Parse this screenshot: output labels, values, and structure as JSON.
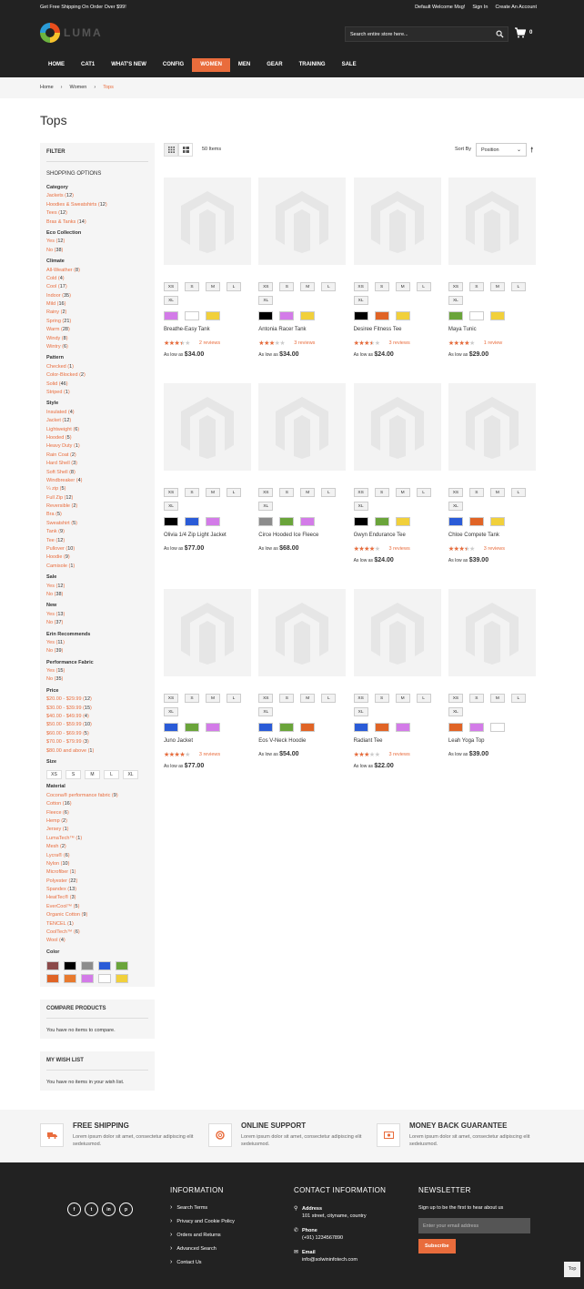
{
  "header": {
    "promo": "Get Free Shipping On Order Over $99!",
    "welcome": "Default Welcome Msg!",
    "sign_in": "Sign In",
    "create_account": "Create An Account",
    "logo_text": "LUMA",
    "search_placeholder": "Search entire store here...",
    "cart_count": "0",
    "nav": [
      {
        "label": "HOME"
      },
      {
        "label": "CAT1"
      },
      {
        "label": "WHAT'S NEW"
      },
      {
        "label": "CONFIG"
      },
      {
        "label": "WOMEN",
        "active": true
      },
      {
        "label": "MEN"
      },
      {
        "label": "GEAR"
      },
      {
        "label": "TRAINING"
      },
      {
        "label": "SALE"
      }
    ]
  },
  "breadcrumb": [
    "Home",
    "Women",
    "Tops"
  ],
  "page_title": "Tops",
  "filter": {
    "title": "FILTER",
    "subtitle": "SHOPPING OPTIONS",
    "groups": [
      {
        "name": "Category",
        "items": [
          [
            "Jackets",
            "12"
          ],
          [
            "Hoodies & Sweatshirts",
            "12"
          ],
          [
            "Tees",
            "12"
          ],
          [
            "Bras & Tanks",
            "14"
          ]
        ]
      },
      {
        "name": "Eco Collection",
        "items": [
          [
            "Yes",
            "12"
          ],
          [
            "No",
            "38"
          ]
        ]
      },
      {
        "name": "Climate",
        "items": [
          [
            "All-Weather",
            "8"
          ],
          [
            "Cold",
            "4"
          ],
          [
            "Cool",
            "17"
          ],
          [
            "Indoor",
            "35"
          ],
          [
            "Mild",
            "16"
          ],
          [
            "Rainy",
            "2"
          ],
          [
            "Spring",
            "21"
          ],
          [
            "Warm",
            "28"
          ],
          [
            "Windy",
            "8"
          ],
          [
            "Wintry",
            "6"
          ]
        ]
      },
      {
        "name": "Pattern",
        "items": [
          [
            "Checked",
            "1"
          ],
          [
            "Color-Blocked",
            "2"
          ],
          [
            "Solid",
            "46"
          ],
          [
            "Striped",
            "1"
          ]
        ]
      },
      {
        "name": "Style",
        "items": [
          [
            "Insulated",
            "4"
          ],
          [
            "Jacket",
            "12"
          ],
          [
            "Lightweight",
            "6"
          ],
          [
            "Hooded",
            "5"
          ],
          [
            "Heavy Duty",
            "1"
          ],
          [
            "Rain Coat",
            "2"
          ],
          [
            "Hard Shell",
            "3"
          ],
          [
            "Soft Shell",
            "8"
          ],
          [
            "Windbreaker",
            "4"
          ],
          [
            "¼ zip",
            "5"
          ],
          [
            "Full Zip",
            "12"
          ],
          [
            "Reversible",
            "2"
          ],
          [
            "Bra",
            "5"
          ],
          [
            "Sweatshirt",
            "5"
          ],
          [
            "Tank",
            "9"
          ],
          [
            "Tee",
            "12"
          ],
          [
            "Pullover",
            "10"
          ],
          [
            "Hoodie",
            "9"
          ],
          [
            "Camisole",
            "1"
          ]
        ]
      },
      {
        "name": "Sale",
        "items": [
          [
            "Yes",
            "12"
          ],
          [
            "No",
            "38"
          ]
        ]
      },
      {
        "name": "New",
        "items": [
          [
            "Yes",
            "13"
          ],
          [
            "No",
            "37"
          ]
        ]
      },
      {
        "name": "Erin Recommends",
        "items": [
          [
            "Yes",
            "11"
          ],
          [
            "No",
            "39"
          ]
        ]
      },
      {
        "name": "Performance Fabric",
        "items": [
          [
            "Yes",
            "15"
          ],
          [
            "No",
            "35"
          ]
        ]
      },
      {
        "name": "Price",
        "items": [
          [
            "$20.00 - $29.99",
            "12"
          ],
          [
            "$30.00 - $39.99",
            "15"
          ],
          [
            "$40.00 - $49.99",
            "4"
          ],
          [
            "$50.00 - $59.99",
            "10"
          ],
          [
            "$60.00 - $69.99",
            "5"
          ],
          [
            "$70.00 - $79.99",
            "3"
          ],
          [
            "$80.00 and above",
            "1"
          ]
        ]
      }
    ],
    "size_label": "Size",
    "sizes": [
      "XS",
      "S",
      "M",
      "L",
      "XL"
    ],
    "material": {
      "name": "Material",
      "items": [
        [
          "Cocona® performance fabric",
          "9"
        ],
        [
          "Cotton",
          "16"
        ],
        [
          "Fleece",
          "6"
        ],
        [
          "Hemp",
          "2"
        ],
        [
          "Jersey",
          "1"
        ],
        [
          "LumaTech™",
          "1"
        ],
        [
          "Mesh",
          "2"
        ],
        [
          "Lycra®",
          "6"
        ],
        [
          "Nylon",
          "10"
        ],
        [
          "Microfiber",
          "1"
        ],
        [
          "Polyester",
          "22"
        ],
        [
          "Spandex",
          "13"
        ],
        [
          "HeatTec®",
          "3"
        ],
        [
          "EverCool™",
          "5"
        ],
        [
          "Organic Cotton",
          "9"
        ],
        [
          "TENCEL",
          "1"
        ],
        [
          "CoolTech™",
          "6"
        ],
        [
          "Wool",
          "4"
        ]
      ]
    },
    "color_label": "Color",
    "colors": [
      "#8b4a4a",
      "#000000",
      "#8c8c8c",
      "#2a5bd7",
      "#6aa43a",
      "#e06426",
      "#e87a2e",
      "#d37be8",
      "#ffffff",
      "#f1d03b"
    ]
  },
  "compare": {
    "title": "COMPARE PRODUCTS",
    "text": "You have no items to compare."
  },
  "wishlist": {
    "title": "MY WISH LIST",
    "text": "You have no items in your wish list."
  },
  "toolbar": {
    "count": "50 Items",
    "sort_label": "Sort By",
    "sort_value": "Position"
  },
  "product_sizes": [
    "XS",
    "S",
    "M",
    "L",
    "XL"
  ],
  "price_prefix": "As low as",
  "products": [
    {
      "name": "Breathe-Easy Tank",
      "rating": 0.7,
      "reviews": "2 reviews",
      "price": "$34.00",
      "colors": [
        "#d37be8",
        "#ffffff",
        "#f1d03b"
      ]
    },
    {
      "name": "Antonia Racer Tank",
      "rating": 0.6,
      "reviews": "3 reviews",
      "price": "$34.00",
      "colors": [
        "#000000",
        "#d37be8",
        "#f1d03b"
      ]
    },
    {
      "name": "Desiree Fitness Tee",
      "rating": 0.7,
      "reviews": "3 reviews",
      "price": "$24.00",
      "colors": [
        "#000000",
        "#e06426",
        "#f1d03b"
      ]
    },
    {
      "name": "Maya Tunic",
      "rating": 0.8,
      "reviews": "1 review",
      "price": "$29.00",
      "colors": [
        "#6aa43a",
        "#ffffff",
        "#f1d03b"
      ]
    },
    {
      "name": "Olivia 1/4 Zip Light Jacket",
      "rating": null,
      "reviews": "",
      "price": "$77.00",
      "colors": [
        "#000000",
        "#2a5bd7",
        "#d37be8"
      ]
    },
    {
      "name": "Circe Hooded Ice Fleece",
      "rating": null,
      "reviews": "",
      "price": "$68.00",
      "colors": [
        "#8c8c8c",
        "#6aa43a",
        "#d37be8"
      ]
    },
    {
      "name": "Gwyn Endurance Tee",
      "rating": 0.8,
      "reviews": "3 reviews",
      "price": "$24.00",
      "colors": [
        "#000000",
        "#6aa43a",
        "#f1d03b"
      ]
    },
    {
      "name": "Chloe Compete Tank",
      "rating": 0.7,
      "reviews": "3 reviews",
      "price": "$39.00",
      "colors": [
        "#2a5bd7",
        "#e06426",
        "#f1d03b"
      ]
    },
    {
      "name": "Juno Jacket",
      "rating": 0.8,
      "reviews": "3 reviews",
      "price": "$77.00",
      "colors": [
        "#2a5bd7",
        "#6aa43a",
        "#d37be8"
      ]
    },
    {
      "name": "Eos V-Neck Hoodie",
      "rating": null,
      "reviews": "",
      "price": "$54.00",
      "colors": [
        "#2a5bd7",
        "#6aa43a",
        "#e06426"
      ]
    },
    {
      "name": "Radiant Tee",
      "rating": 0.6,
      "reviews": "3 reviews",
      "price": "$22.00",
      "colors": [
        "#2a5bd7",
        "#e06426",
        "#d37be8"
      ]
    },
    {
      "name": "Leah Yoga Top",
      "rating": null,
      "reviews": "",
      "price": "$39.00",
      "colors": [
        "#e06426",
        "#d37be8",
        "#ffffff"
      ]
    }
  ],
  "features": [
    {
      "title": "FREE SHIPPING",
      "desc": "Lorem ipsum dolor sit amet, consectetur adipiscing elit sedeiusmod.",
      "icon": "truck-icon"
    },
    {
      "title": "ONLINE SUPPORT",
      "desc": "Lorem ipsum dolor sit amet, consectetur adipiscing elit sedeiusmod.",
      "icon": "lifebuoy-icon"
    },
    {
      "title": "MONEY BACK GUARANTEE",
      "desc": "Lorem ipsum dolor sit amet, consectetur adipiscing elit sedeiusmod.",
      "icon": "money-icon"
    }
  ],
  "footer": {
    "socials": [
      "f",
      "t",
      "in",
      "p"
    ],
    "info_title": "INFORMATION",
    "info_links": [
      "Search Terms",
      "Privacy and Cookie Policy",
      "Orders and Returns",
      "Advanced Search",
      "Contact Us"
    ],
    "contact_title": "CONTACT INFORMATION",
    "address_label": "Address",
    "address": "101 street, cityname, country",
    "phone_label": "Phone",
    "phone": "(+91) 1234567890",
    "email_label": "Email",
    "email": "info@solwininfotech.com",
    "newsletter_title": "NEWSLETTER",
    "newsletter_text": "Sign up to be the first to hear about us",
    "newsletter_placeholder": "Enter your email address",
    "subscribe": "Subscribe",
    "top": "Top"
  }
}
